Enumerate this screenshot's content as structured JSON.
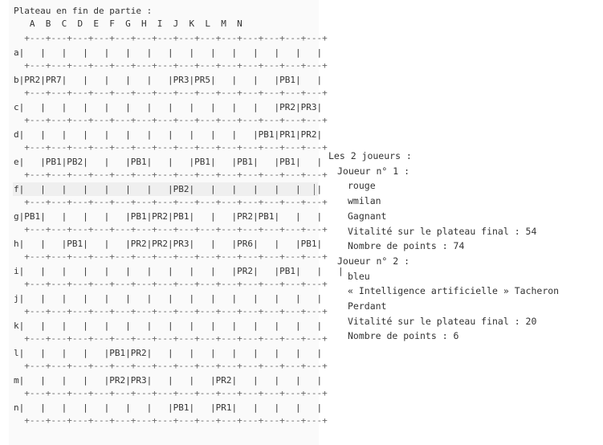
{
  "board": {
    "title": "Plateau en fin de partie :",
    "columns": [
      "A",
      "B",
      "C",
      "D",
      "E",
      "F",
      "G",
      "H",
      "I",
      "J",
      "K",
      "L",
      "M",
      "N"
    ],
    "rows": [
      {
        "label": "a",
        "cells": [
          "",
          "",
          "",
          "",
          "",
          "",
          "",
          "",
          "",
          "",
          "",
          "",
          "",
          ""
        ]
      },
      {
        "label": "b",
        "cells": [
          "PR2",
          "PR7",
          "",
          "",
          "",
          "",
          "",
          "PR3",
          "PR5",
          "",
          "",
          "",
          "PB1",
          ""
        ]
      },
      {
        "label": "c",
        "cells": [
          "",
          "",
          "",
          "",
          "",
          "",
          "",
          "",
          "",
          "",
          "",
          "",
          "PR2",
          "PR3"
        ]
      },
      {
        "label": "d",
        "cells": [
          "",
          "",
          "",
          "",
          "",
          "",
          "",
          "",
          "",
          "",
          "",
          "PB1",
          "PR1",
          "PR2"
        ]
      },
      {
        "label": "e",
        "cells": [
          "",
          "PB1",
          "PB2",
          "",
          "",
          "PB1",
          "",
          "",
          "PB1",
          "",
          "PB1",
          "",
          "PB1",
          ""
        ]
      },
      {
        "label": "f",
        "cells": [
          "",
          "",
          "",
          "",
          "",
          "",
          "",
          "PB2",
          "",
          "",
          "",
          "",
          "",
          ""
        ]
      },
      {
        "label": "g",
        "cells": [
          "PB1",
          "",
          "",
          "",
          "",
          "PB1",
          "PR2",
          "PB1",
          "",
          "",
          "PR2",
          "PB1",
          "",
          ""
        ]
      },
      {
        "label": "h",
        "cells": [
          "",
          "",
          "PB1",
          "",
          "",
          "PR2",
          "PR2",
          "PR3",
          "",
          "",
          "PR6",
          "",
          "",
          "PB1"
        ]
      },
      {
        "label": "i",
        "cells": [
          "",
          "",
          "",
          "",
          "",
          "",
          "",
          "",
          "",
          "",
          "PR2",
          "",
          "PB1",
          "",
          ""
        ]
      },
      {
        "label": "j",
        "cells": [
          "",
          "",
          "",
          "",
          "",
          "",
          "",
          "",
          "",
          "",
          "",
          "",
          "",
          ""
        ]
      },
      {
        "label": "k",
        "cells": [
          "",
          "",
          "",
          "",
          "",
          "",
          "",
          "",
          "",
          "",
          "",
          "",
          "",
          ""
        ]
      },
      {
        "label": "l",
        "cells": [
          "",
          "",
          "",
          "",
          "PB1",
          "PR2",
          "",
          "",
          "",
          "",
          "",
          "",
          "",
          ""
        ]
      },
      {
        "label": "m",
        "cells": [
          "",
          "",
          "",
          "",
          "PR2",
          "PR3",
          "",
          "",
          "",
          "PR2",
          "",
          "",
          "",
          ""
        ]
      },
      {
        "label": "n",
        "cells": [
          "",
          "",
          "",
          "",
          "",
          "",
          "",
          "PB1",
          "",
          "PR1",
          "",
          "",
          "",
          ""
        ]
      }
    ]
  },
  "players": {
    "heading": "Les 2 joueurs :",
    "list": [
      {
        "title": "Joueur n° 1 :",
        "color": "rouge",
        "name": "wmilan",
        "result": "Gagnant",
        "vitality": "Vitalité sur le plateau final : 54",
        "points": "Nombre de points : 74"
      },
      {
        "title": "Joueur n° 2 :",
        "color": "bleu",
        "name": "« Intelligence artificielle » Tacheron",
        "result": "Perdant",
        "vitality": "Vitalité sur le plateau final : 20",
        "points": "Nombre de points : 6"
      }
    ]
  }
}
